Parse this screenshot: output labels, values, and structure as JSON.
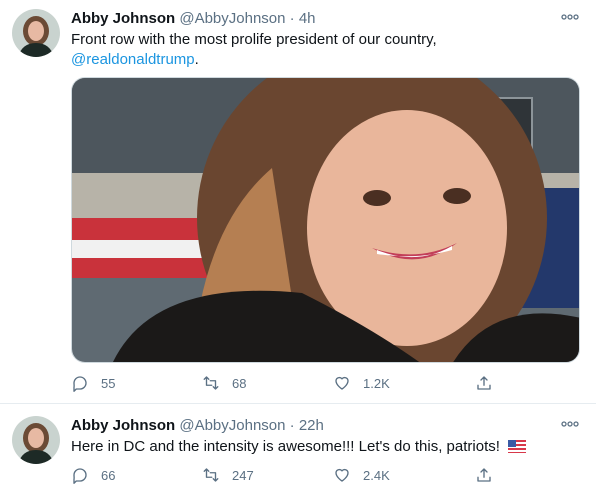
{
  "tweets": [
    {
      "name": "Abby Johnson",
      "handle": "@AbbyJohnson",
      "separator": "·",
      "time": "4h",
      "text": "Front row with the most prolife president of our country,",
      "mention": "@realdonaldtrump",
      "text_end": ".",
      "replies": "55",
      "retweets": "68",
      "likes": "1.2K",
      "has_media": true
    },
    {
      "name": "Abby Johnson",
      "handle": "@AbbyJohnson",
      "separator": "·",
      "time": "22h",
      "text": "Here in DC and the intensity is awesome!!! Let's do this, patriots!",
      "emoji": "us-flag",
      "replies": "66",
      "retweets": "247",
      "likes": "2.4K"
    }
  ],
  "icons": {
    "more": "more-icon",
    "reply": "reply-icon",
    "retweet": "retweet-icon",
    "like": "like-icon",
    "share": "share-icon"
  },
  "colors": {
    "name": "#0f1419",
    "secondary": "#5b7083",
    "link": "#1b95e0",
    "divider": "#e6ecf0"
  }
}
